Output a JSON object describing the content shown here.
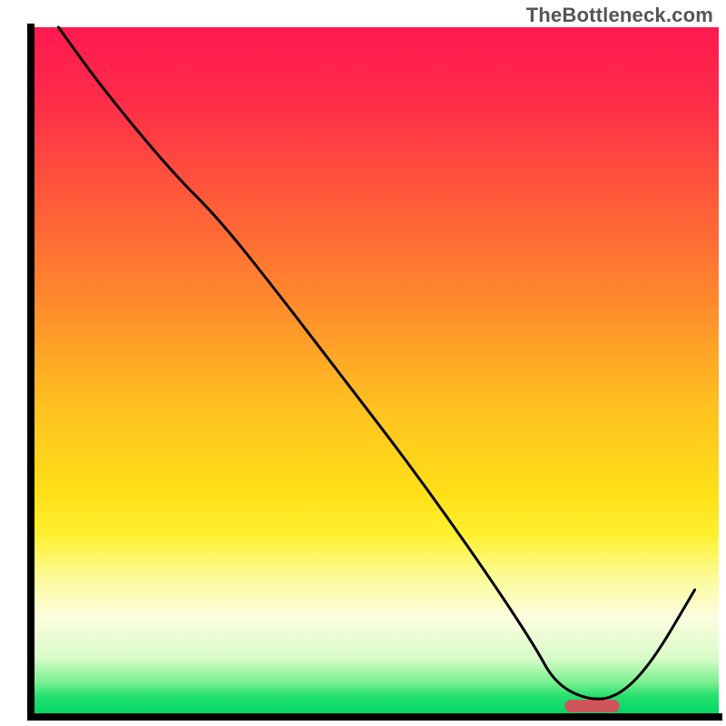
{
  "watermark": "TheBottleneck.com",
  "chart_data": {
    "type": "line",
    "title": "",
    "xlabel": "",
    "ylabel": "",
    "xlim": [
      0,
      100
    ],
    "ylim": [
      0,
      100
    ],
    "grid": false,
    "legend": false,
    "gradient_stops": [
      {
        "offset": 0.0,
        "color": "#ff1a4f"
      },
      {
        "offset": 0.1,
        "color": "#ff2a4a"
      },
      {
        "offset": 0.25,
        "color": "#ff5a3a"
      },
      {
        "offset": 0.4,
        "color": "#ff8a2d"
      },
      {
        "offset": 0.55,
        "color": "#ffc020"
      },
      {
        "offset": 0.68,
        "color": "#ffe018"
      },
      {
        "offset": 0.74,
        "color": "#fff030"
      },
      {
        "offset": 0.8,
        "color": "#fbfb95"
      },
      {
        "offset": 0.86,
        "color": "#fdfde0"
      },
      {
        "offset": 0.92,
        "color": "#d8fbc8"
      },
      {
        "offset": 0.955,
        "color": "#7af090"
      },
      {
        "offset": 0.975,
        "color": "#25e070"
      },
      {
        "offset": 1.0,
        "color": "#00d864"
      }
    ],
    "line": {
      "x": [
        3.5,
        10,
        20,
        27,
        35,
        45,
        55,
        65,
        73,
        76,
        80.5,
        85,
        90,
        96.5
      ],
      "y": [
        100,
        91,
        79,
        72,
        62,
        49,
        36,
        22,
        10,
        4.5,
        2,
        2.2,
        7,
        18
      ]
    },
    "marker": {
      "x_start": 77.5,
      "x_end": 85.5,
      "color": "#d0555a",
      "radius_pct": 0.9
    },
    "axes_color": "#000000",
    "line_color": "#000000",
    "line_width": 3
  }
}
